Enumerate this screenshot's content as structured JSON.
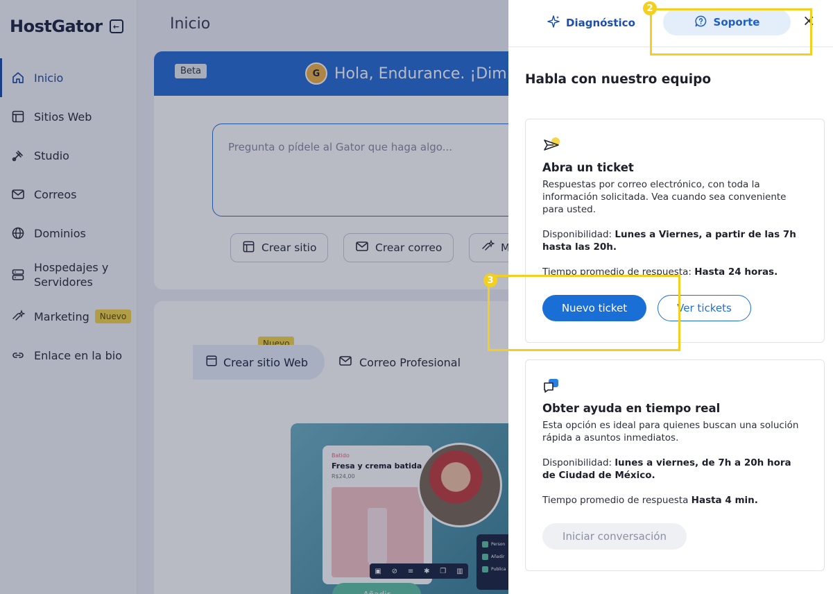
{
  "sidebar": {
    "logo": "HostGator",
    "items": [
      {
        "label": "Inicio"
      },
      {
        "label": "Sitios Web"
      },
      {
        "label": "Studio"
      },
      {
        "label": "Correos"
      },
      {
        "label": "Dominios"
      },
      {
        "label": "Hospedajes y Servidores"
      },
      {
        "label": "Marketing",
        "badge": "Nuevo"
      },
      {
        "label": "Enlace en la bio"
      }
    ]
  },
  "main": {
    "page_title": "Inicio",
    "hero": {
      "beta": "Beta",
      "greeting": "Hola, Endurance. ¡Dim",
      "prompt_placeholder": "Pregunta o pídele al Gator que haga algo...",
      "chips": [
        "Crear sitio",
        "Crear correo",
        "M"
      ]
    },
    "section": {
      "tab_web": "Crear sitio Web",
      "tab_web_badge": "Nuevo",
      "tab_mail": "Correo Profesional",
      "preview": {
        "category": "Batido",
        "title": "Fresa y crema batida",
        "price": "R$24,00",
        "add_button": "Añadir",
        "checklist": [
          "Person",
          "Añadir",
          "Publica"
        ]
      }
    }
  },
  "panel": {
    "tabs": {
      "diagnostic": "Diagnóstico",
      "support": "Soporte"
    },
    "close": "×",
    "title": "Habla con nuestro equipo",
    "ticket_card": {
      "title": "Abra un ticket",
      "description": "Respuestas por correo electrónico, con toda la información solicitada. Vea cuando sea conveniente para usted.",
      "availability_label": "Disponibilidad:",
      "availability_value": "Lunes a Viernes, a partir de las 7h hasta las 20h.",
      "response_label": "Tiempo promedio de respuesta:",
      "response_value": "Hasta 24 horas.",
      "primary_button": "Nuevo ticket",
      "secondary_button": "Ver tickets"
    },
    "chat_card": {
      "title": "Obter ayuda en tiempo real",
      "description": "Esta opción es ideal para quienes buscan una solución rápida a asuntos inmediatos.",
      "availability_label": "Disponibilidad:",
      "availability_value": "lunes a viernes, de 7h a 20h hora de Ciudad de México.",
      "response_label": "Tiempo promedio de respuesta",
      "response_value": "Hasta 4 min.",
      "button": "Iniciar conversación"
    }
  },
  "annotations": [
    {
      "number": "2"
    },
    {
      "number": "3"
    }
  ],
  "colors": {
    "accent": "#1a6fd6",
    "highlight": "#f3cf1f",
    "badge": "#f4d64a"
  }
}
